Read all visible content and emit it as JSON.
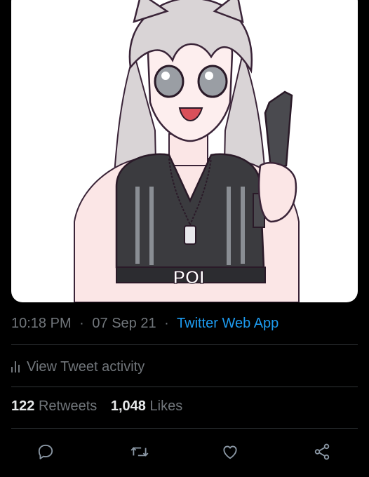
{
  "tweet": {
    "image_caption": "POI",
    "time": "10:18 PM",
    "date": "07 Sep 21",
    "separator": "·",
    "source": "Twitter Web App"
  },
  "activity": {
    "label": "View Tweet activity"
  },
  "stats": {
    "retweets_count": "122",
    "retweets_label": "Retweets",
    "likes_count": "1,048",
    "likes_label": "Likes"
  },
  "actions": {
    "icons": [
      "reply-icon",
      "retweet-icon",
      "like-icon",
      "share-icon"
    ]
  },
  "colors": {
    "background": "#000000",
    "text_primary": "#e7e9ea",
    "text_secondary": "#71767b",
    "link": "#1d9bf0",
    "divider": "#2f3336"
  }
}
